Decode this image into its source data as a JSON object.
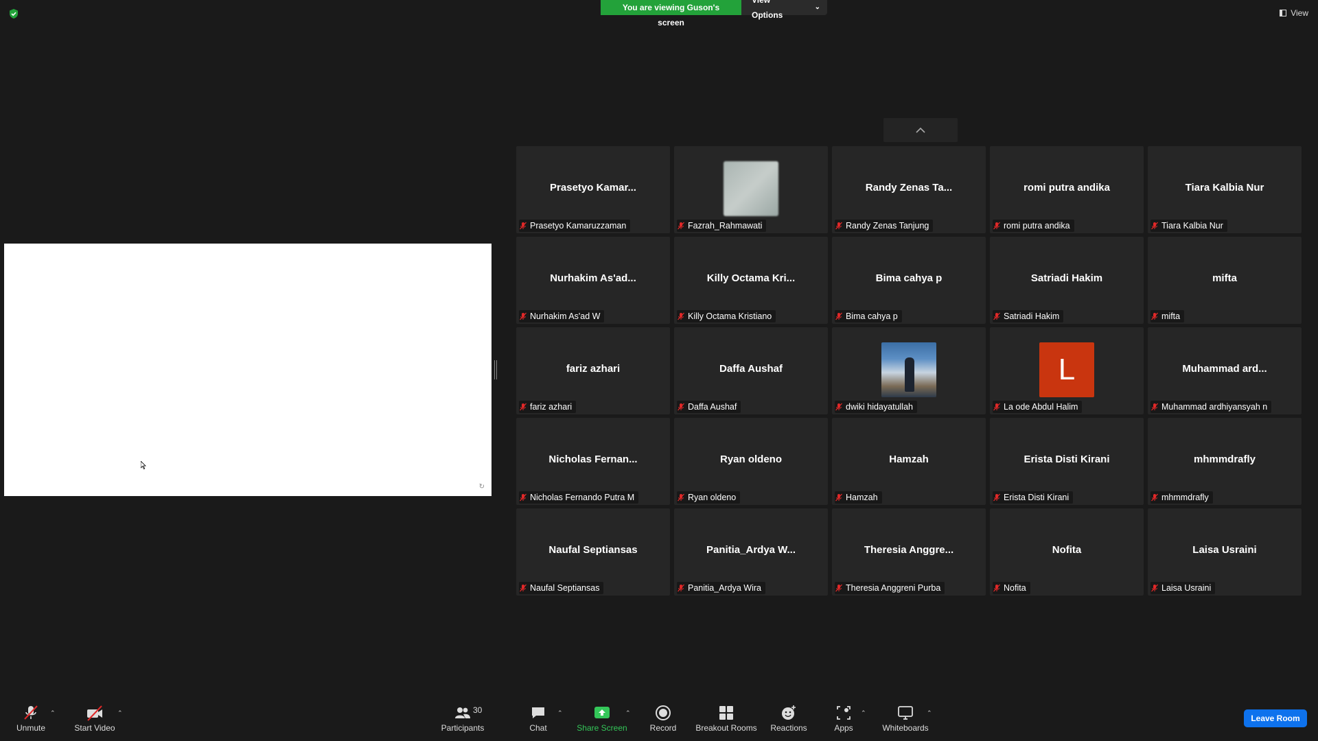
{
  "banner": {
    "text": "You are viewing Guson's screen",
    "view_options": "View Options"
  },
  "view_button": "View",
  "participants": [
    {
      "center": "Prasetyo  Kamar...",
      "label": "Prasetyo Kamaruzzaman",
      "avatar": "none"
    },
    {
      "center": "",
      "label": "Fazrah_Rahmawati",
      "avatar": "blur"
    },
    {
      "center": "Randy  Zenas  Ta...",
      "label": "Randy Zenas Tanjung",
      "avatar": "none"
    },
    {
      "center": "romi putra andika",
      "label": "romi putra andika",
      "avatar": "none"
    },
    {
      "center": "Tiara Kalbia Nur",
      "label": "Tiara Kalbia Nur",
      "avatar": "none"
    },
    {
      "center": "Nurhakim  As'ad...",
      "label": "Nurhakim As'ad W",
      "avatar": "none"
    },
    {
      "center": "Killy  Octama  Kri...",
      "label": "Killy Octama Kristiano",
      "avatar": "none"
    },
    {
      "center": "Bima cahya p",
      "label": "Bima cahya p",
      "avatar": "none"
    },
    {
      "center": "Satriadi Hakim",
      "label": "Satriadi Hakim",
      "avatar": "none"
    },
    {
      "center": "mifta",
      "label": "mifta",
      "avatar": "none"
    },
    {
      "center": "fariz azhari",
      "label": "fariz azhari",
      "avatar": "none"
    },
    {
      "center": "Daffa Aushaf",
      "label": "Daffa Aushaf",
      "avatar": "none"
    },
    {
      "center": "",
      "label": "dwiki hidayatullah",
      "avatar": "photo"
    },
    {
      "center": "",
      "label": "La ode Abdul Halim",
      "avatar": "letter",
      "letter": "L"
    },
    {
      "center": "Muhammad  ard...",
      "label": "Muhammad ardhiyansyah n",
      "avatar": "none"
    },
    {
      "center": "Nicholas  Fernan...",
      "label": "Nicholas Fernando Putra M",
      "avatar": "none"
    },
    {
      "center": "Ryan oldeno",
      "label": "Ryan oldeno",
      "avatar": "none"
    },
    {
      "center": "Hamzah",
      "label": "Hamzah",
      "avatar": "none"
    },
    {
      "center": "Erista Disti Kirani",
      "label": "Erista Disti Kirani",
      "avatar": "none"
    },
    {
      "center": "mhmmdrafly",
      "label": "mhmmdrafly",
      "avatar": "none"
    },
    {
      "center": "Naufal Septiansas",
      "label": "Naufal Septiansas",
      "avatar": "none"
    },
    {
      "center": "Panitia_Ardya  W...",
      "label": "Panitia_Ardya Wira",
      "avatar": "none"
    },
    {
      "center": "Theresia  Anggre...",
      "label": "Theresia Anggreni Purba",
      "avatar": "none"
    },
    {
      "center": "Nofita",
      "label": "Nofita",
      "avatar": "none"
    },
    {
      "center": "Laisa Usraini",
      "label": "Laisa Usraini",
      "avatar": "none"
    }
  ],
  "toolbar": {
    "unmute": "Unmute",
    "start_video": "Start Video",
    "participants": "Participants",
    "participants_count": "30",
    "chat": "Chat",
    "share_screen": "Share Screen",
    "record": "Record",
    "breakout_rooms": "Breakout Rooms",
    "reactions": "Reactions",
    "apps": "Apps",
    "whiteboards": "Whiteboards",
    "leave": "Leave Room"
  },
  "colors": {
    "share_green": "#23a23a",
    "leave_blue": "#0e72ed",
    "muted_red": "#e02828",
    "letter_avatar": "#c9350f"
  }
}
